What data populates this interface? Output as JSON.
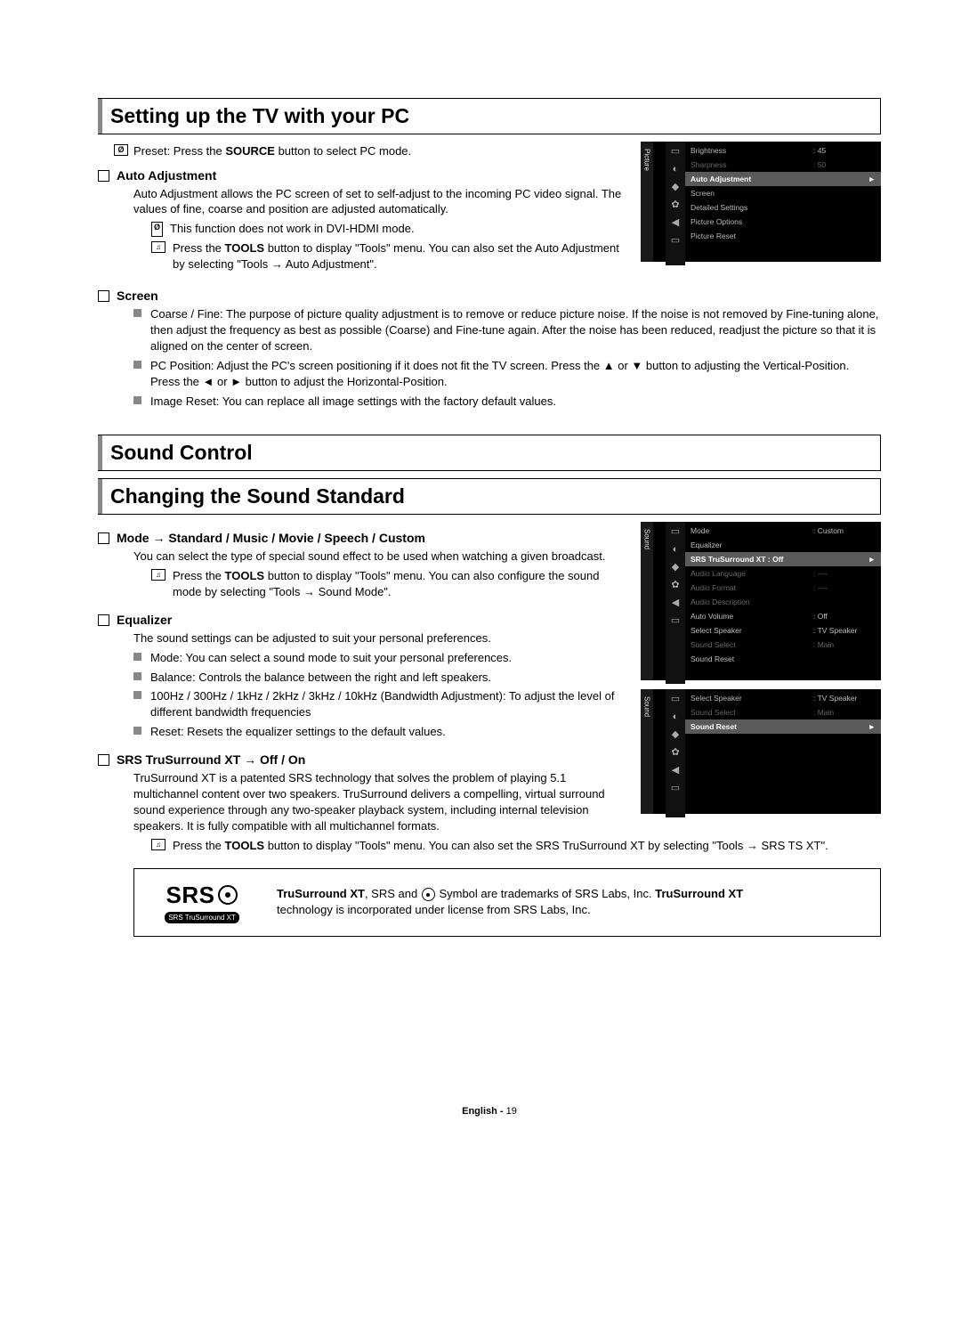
{
  "section1": {
    "title": "Setting up the TV with your PC",
    "preset_note": "Preset: Press the <b>SOURCE</b> button to select PC mode.",
    "auto_adjustment": {
      "heading": "Auto Adjustment",
      "desc": "Auto Adjustment allows the PC screen of set to self-adjust to the incoming PC video signal. The values of fine, coarse and position are adjusted automatically.",
      "note1": "This function does not work in DVI-HDMI mode.",
      "note2": "Press the <b>TOOLS</b> button to display \"Tools\" menu. You can also set the Auto Adjustment by selecting \"Tools → Auto Adjustment\"."
    },
    "screen": {
      "heading": "Screen",
      "item1": "Coarse / Fine: The purpose of picture quality adjustment is to remove or reduce picture noise. If the noise is not removed by Fine-tuning alone, then adjust the frequency as best as possible (Coarse) and Fine-tune again. After the noise has been reduced, readjust the picture so that it is aligned on the center of screen.",
      "item2": "PC Position: Adjust the PC's screen positioning if it does not fit the TV screen. Press the ▲ or ▼ button to adjusting the Vertical-Position. Press the ◄ or ► button to adjust the Horizontal-Position.",
      "item3": "Image Reset: You can replace all image settings with the factory default values."
    }
  },
  "osd1": {
    "tab": "Picture",
    "rows": [
      {
        "label": "Brightness",
        "val": ": 45",
        "cls": ""
      },
      {
        "label": "Sharpness",
        "val": ": 50",
        "cls": "dim"
      },
      {
        "label": "Auto Adjustment",
        "val": "",
        "cls": "highlight",
        "arrow": "►"
      },
      {
        "label": "Screen",
        "val": "",
        "cls": ""
      },
      {
        "label": "Detailed Settings",
        "val": "",
        "cls": ""
      },
      {
        "label": "Picture Options",
        "val": "",
        "cls": ""
      },
      {
        "label": "Picture Reset",
        "val": "",
        "cls": ""
      }
    ]
  },
  "section2": {
    "title1": "Sound Control",
    "title2": "Changing the Sound Standard",
    "mode": {
      "heading": "Mode → Standard / Music / Movie / Speech / Custom",
      "desc": "You can select the type of special sound effect to be used when watching a given broadcast.",
      "note": "Press the <b>TOOLS</b> button to display \"Tools\" menu. You can also configure the sound mode by selecting \"Tools → Sound Mode\"."
    },
    "equalizer": {
      "heading": "Equalizer",
      "desc": "The sound settings can be adjusted to suit your personal preferences.",
      "i1": "Mode: You can select a sound mode to suit your personal preferences.",
      "i2": "Balance: Controls the balance between the right and left speakers.",
      "i3": "100Hz / 300Hz / 1kHz / 2kHz / 3kHz / 10kHz (Bandwidth Adjustment): To adjust the level of different bandwidth frequencies",
      "i4": "Reset: Resets the equalizer settings to the default values."
    },
    "srs": {
      "heading": "SRS TruSurround XT → Off / On",
      "desc": "TruSurround XT is a patented SRS technology that solves the problem of playing 5.1 multichannel content over two speakers. TruSurround delivers a compelling, virtual surround sound experience through any two-speaker playback system, including internal television speakers. It is fully compatible with all multichannel formats.",
      "note": "Press the <b>TOOLS</b> button to display \"Tools\" menu. You can also set the SRS TruSurround XT by selecting \"Tools → SRS TS XT\"."
    }
  },
  "osd2a": {
    "tab": "Sound",
    "rows": [
      {
        "label": "Mode",
        "val": ": Custom",
        "cls": ""
      },
      {
        "label": "Equalizer",
        "val": "",
        "cls": ""
      },
      {
        "label": "SRS TruSurround XT  : Off",
        "val": "",
        "cls": "highlight",
        "arrow": "►"
      },
      {
        "label": "Audio Language",
        "val": ": ----",
        "cls": "dim"
      },
      {
        "label": "Audio Format",
        "val": ": ----",
        "cls": "dim"
      },
      {
        "label": "Audio Description",
        "val": "",
        "cls": "dim"
      },
      {
        "label": "Auto Volume",
        "val": ": Off",
        "cls": ""
      },
      {
        "label": "Select Speaker",
        "val": ": TV Speaker",
        "cls": ""
      },
      {
        "label": "Sound Select",
        "val": ": Main",
        "cls": "dim"
      },
      {
        "label": "Sound Reset",
        "val": "",
        "cls": ""
      }
    ]
  },
  "osd2b": {
    "tab": "Sound",
    "rows": [
      {
        "label": "Select Speaker",
        "val": ": TV Speaker",
        "cls": ""
      },
      {
        "label": "Sound Select",
        "val": ": Main",
        "cls": "dim"
      },
      {
        "label": "Sound Reset",
        "val": "",
        "cls": "highlight",
        "arrow": "►"
      }
    ]
  },
  "srs_box": {
    "logo_main": "SRS",
    "logo_sub": "SRS TruSurround XT",
    "line1_a": "TruSurround XT",
    "line1_b": ", SRS and ",
    "line1_c": " Symbol are trademarks of SRS Labs, Inc. ",
    "line1_d": "TruSurround XT",
    "line2": "technology is incorporated under license from SRS Labs, Inc."
  },
  "footer": {
    "lang": "English - ",
    "page": "19"
  },
  "icons": [
    "▭",
    "◐",
    "◆",
    "✿",
    "◀",
    "▭"
  ]
}
